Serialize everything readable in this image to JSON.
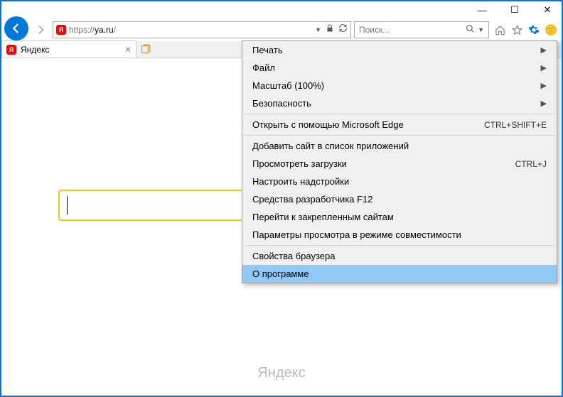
{
  "windowControls": {
    "minimize": "—",
    "maximize": "☐",
    "close": "✕"
  },
  "addressBar": {
    "protocol": "https://",
    "host": "ya.ru",
    "path": "/"
  },
  "searchBar": {
    "placeholder": "Поиск..."
  },
  "tab": {
    "title": "Яндекс"
  },
  "page": {
    "footer": "Яндекс"
  },
  "menu": {
    "print": "Печать",
    "file": "Файл",
    "zoom": "Масштаб (100%)",
    "safety": "Безопасность",
    "openEdge": "Открыть с помощью Microsoft Edge",
    "openEdgeShortcut": "CTRL+SHIFT+E",
    "addSite": "Добавить сайт в список приложений",
    "viewDownloads": "Просмотреть загрузки",
    "viewDownloadsShortcut": "CTRL+J",
    "addons": "Настроить надстройки",
    "devtools": "Средства разработчика F12",
    "pinned": "Перейти к закрепленным сайтам",
    "compat": "Параметры просмотра в режиме совместимости",
    "options": "Свойства браузера",
    "about": "О программе"
  }
}
